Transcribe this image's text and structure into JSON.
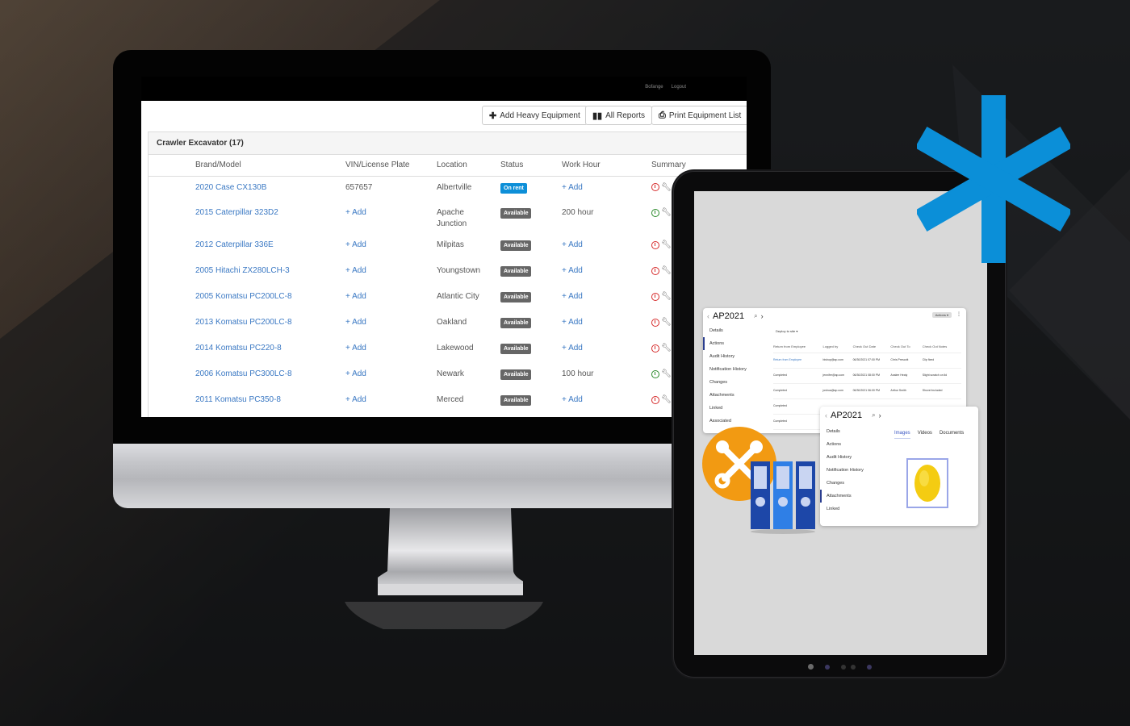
{
  "desktop_app": {
    "topbar_links": [
      "Bofange",
      "Logout"
    ],
    "toolbar": {
      "add_label": "Add Heavy Equipment",
      "reports_label": "All Reports",
      "print_label": "Print Equipment List"
    },
    "panel_title": "Crawler Excavator (17)",
    "columns": [
      "Brand/Model",
      "VIN/License Plate",
      "Location",
      "Status",
      "Work Hour",
      "Summary"
    ],
    "rows": [
      {
        "model": "2020 Case CX130B",
        "vin": "657657",
        "location": "Albertville",
        "status": "On rent",
        "work_hour": "+ Add",
        "summary_state": "red"
      },
      {
        "model": "2015 Caterpillar 323D2",
        "vin": "+ Add",
        "location": "Apache Junction",
        "status": "Available",
        "work_hour": "200 hour",
        "summary_state": "green"
      },
      {
        "model": "2012 Caterpillar 336E",
        "vin": "+ Add",
        "location": "Milpitas",
        "status": "Available",
        "work_hour": "+ Add",
        "summary_state": "red"
      },
      {
        "model": "2005 Hitachi ZX280LCH-3",
        "vin": "+ Add",
        "location": "Youngstown",
        "status": "Available",
        "work_hour": "+ Add",
        "summary_state": "red"
      },
      {
        "model": "2005 Komatsu PC200LC-8",
        "vin": "+ Add",
        "location": "Atlantic City",
        "status": "Available",
        "work_hour": "+ Add",
        "summary_state": "red"
      },
      {
        "model": "2013 Komatsu PC200LC-8",
        "vin": "+ Add",
        "location": "Oakland",
        "status": "Available",
        "work_hour": "+ Add",
        "summary_state": "red"
      },
      {
        "model": "2014 Komatsu PC220-8",
        "vin": "+ Add",
        "location": "Lakewood",
        "status": "Available",
        "work_hour": "+ Add",
        "summary_state": "red"
      },
      {
        "model": "2006 Komatsu PC300LC-8",
        "vin": "+ Add",
        "location": "Newark",
        "status": "Available",
        "work_hour": "100 hour",
        "summary_state": "green"
      },
      {
        "model": "2011 Komatsu PC350-8",
        "vin": "+ Add",
        "location": "Merced",
        "status": "Available",
        "work_hour": "+ Add",
        "summary_state": "red"
      }
    ]
  },
  "tablet_app": {
    "card1": {
      "title": "AP2021",
      "actions_label": "Actions",
      "nav": [
        "Details",
        "Actions",
        "Audit History",
        "Notification History",
        "Changes",
        "Attachments",
        "Linked",
        "Associated"
      ],
      "active_nav": "Actions",
      "filter_label": "Deploy to site",
      "columns": [
        "Return from Employee",
        "Logged by",
        "Check Out Date",
        "Check Out To",
        "Check Out Notes"
      ],
      "rows": [
        [
          "Return from Employee",
          "bishop@ap.com",
          "06/30/2021 07:00 PM",
          "Chris Prescott",
          "Clip fixed"
        ],
        [
          "Completed",
          "jennifer@ap.com",
          "06/30/2021 08:00 PM",
          "Analee Healy",
          "Slight scratch on lid"
        ],
        [
          "Completed",
          "joshua@ap.com",
          "06/30/2021 06:00 PM",
          "Arthur Smith",
          "Shovel included"
        ],
        [
          "Completed",
          "",
          "",
          "",
          ""
        ],
        [
          "Completed",
          "",
          "",
          "",
          ""
        ]
      ]
    },
    "card2": {
      "title": "AP2021",
      "nav": [
        "Details",
        "Actions",
        "Audit History",
        "Notification History",
        "Changes",
        "Attachments",
        "Linked"
      ],
      "active_nav": "Attachments",
      "tabs": [
        "Images",
        "Videos",
        "Documents"
      ],
      "active_tab": "Images",
      "image_label": "hard-hat"
    }
  },
  "colors": {
    "brand_blue": "#0d8fd8",
    "link_blue": "#3a78c3",
    "orange": "#f29a12",
    "status_red": "#d62b2b",
    "status_green": "#2a8a2a"
  }
}
